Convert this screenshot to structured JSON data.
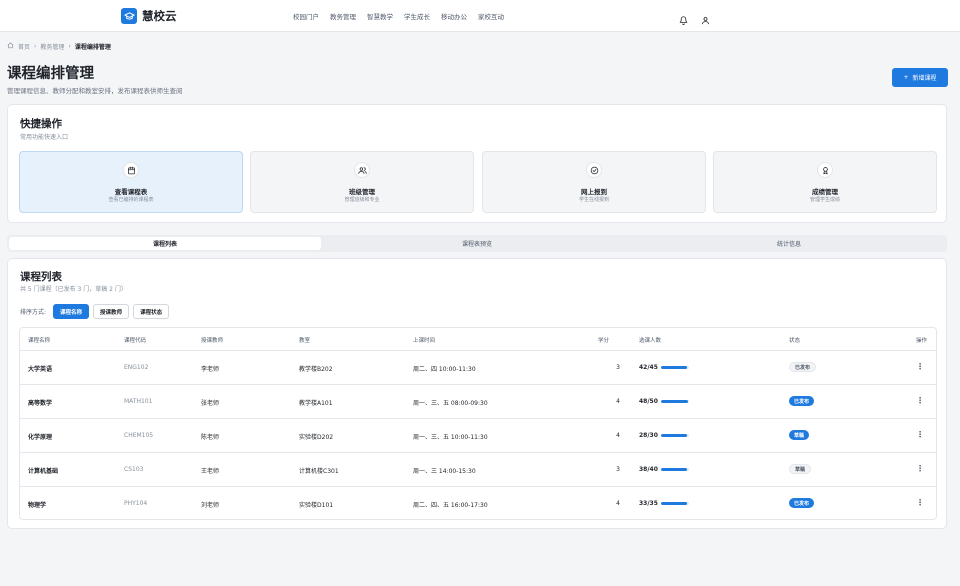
{
  "brand": {
    "name": "慧校云",
    "accent": "#1f7ae0"
  },
  "nav": {
    "links": [
      "校园门户",
      "教务管理",
      "智慧教学",
      "学生成长",
      "移动办公",
      "家校互动"
    ],
    "icons": [
      "bell-icon",
      "user-icon"
    ]
  },
  "breadcrumb": {
    "home": "首页",
    "parent": "教务管理",
    "current": "课程编排管理"
  },
  "header": {
    "title": "课程编排管理",
    "subtitle": "管理课程信息、教师分配和教室安排，发布课程表供师生查阅",
    "add_button": "新增课程"
  },
  "quick_actions": {
    "title": "快捷操作",
    "subtitle": "常用功能快速入口",
    "items": [
      {
        "label": "查看课程表",
        "desc": "查看已编排的课程表",
        "icon": "calendar-icon"
      },
      {
        "label": "班级管理",
        "desc": "管理班级和专业",
        "icon": "users-icon"
      },
      {
        "label": "网上报到",
        "desc": "学生在线报到",
        "icon": "check-circle-icon"
      },
      {
        "label": "成绩管理",
        "desc": "管理学生成绩",
        "icon": "award-icon"
      }
    ]
  },
  "tabs": [
    "课程列表",
    "课程表预览",
    "统计信息"
  ],
  "course_list": {
    "title": "课程列表",
    "summary": "共 5 门课程（已发布 3 门，草稿 2 门）",
    "sort_label": "排序方式:",
    "sort_options": [
      "课程名称",
      "授课教师",
      "课程状态"
    ],
    "columns": [
      "课程名称",
      "课程代码",
      "授课教师",
      "教室",
      "上课时间",
      "学分",
      "选课人数",
      "状态",
      "操作"
    ],
    "rows": [
      {
        "name": "大学英语",
        "code": "ENG102",
        "teacher": "李老师",
        "room": "教学楼B202",
        "time": "周二、四 10:00-11:30",
        "credit": "3",
        "enroll": "42/45",
        "fill": 0.93,
        "status": "已发布",
        "status_style": "grey"
      },
      {
        "name": "高等数学",
        "code": "MATH101",
        "teacher": "张老师",
        "room": "教学楼A101",
        "time": "周一、三、五 08:00-09:30",
        "credit": "4",
        "enroll": "48/50",
        "fill": 0.96,
        "status": "已发布",
        "status_style": "blue"
      },
      {
        "name": "化学原理",
        "code": "CHEM105",
        "teacher": "陈老师",
        "room": "实验楼D202",
        "time": "周一、三、五 10:00-11:30",
        "credit": "4",
        "enroll": "28/30",
        "fill": 0.93,
        "status": "草稿",
        "status_style": "blue"
      },
      {
        "name": "计算机基础",
        "code": "CS103",
        "teacher": "王老师",
        "room": "计算机楼C301",
        "time": "周一、三 14:00-15:30",
        "credit": "3",
        "enroll": "38/40",
        "fill": 0.95,
        "status": "草稿",
        "status_style": "grey"
      },
      {
        "name": "物理学",
        "code": "PHY104",
        "teacher": "刘老师",
        "room": "实验楼D101",
        "time": "周二、四、五 16:00-17:30",
        "credit": "4",
        "enroll": "33/35",
        "fill": 0.94,
        "status": "已发布",
        "status_style": "blue"
      }
    ]
  }
}
